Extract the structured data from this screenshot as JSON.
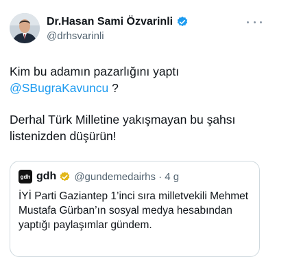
{
  "author": {
    "display_name": "Dr.Hasan Sami Özvarinli",
    "handle": "@drhsvarinli",
    "verified_icon": "verified-badge-icon"
  },
  "tweet": {
    "line1": "Kim bu adamın pazarlığını yaptı",
    "mention": "@SBugraKavuncu",
    "mention_suffix": " ?",
    "line3": "Derhal Türk Milletine yakışmayan bu şahsı",
    "line4": "listenizden düşürün!"
  },
  "quoted": {
    "logo_text": "gdh",
    "name": "gdh",
    "handle_time": "@gundemedairhs · 4 g",
    "text_lines": [
      "İYİ Parti Gaziantep 1’inci sıra milletvekili Mehmet",
      "Mustafa Gürban’ın sosyal medya hesabından",
      "yaptığı paylaşımlar gündem."
    ]
  },
  "colors": {
    "link": "#1d9bf0",
    "secondary_text": "#536471",
    "verified_blue": "#1d9bf0",
    "verified_gold": "#e2b719"
  }
}
